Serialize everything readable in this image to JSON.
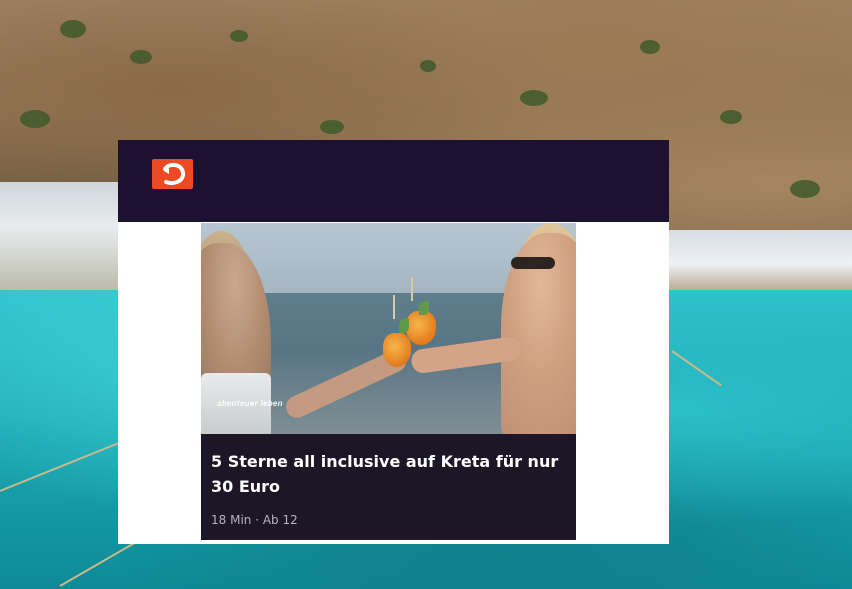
{
  "colors": {
    "header_bg": "#1c1130",
    "card_bg": "#1c1626",
    "logo_bg": "#ec4a24",
    "title_text": "#ffffff",
    "meta_text": "#b7b3bf"
  },
  "header": {
    "logo_icon": "kabel-eins-logo-icon"
  },
  "video": {
    "channel_logo_text": "abenteuer leben",
    "title": "5 Sterne all inclusive auf Kreta für nur 30 Euro",
    "meta": "18 Min · Ab 12"
  }
}
